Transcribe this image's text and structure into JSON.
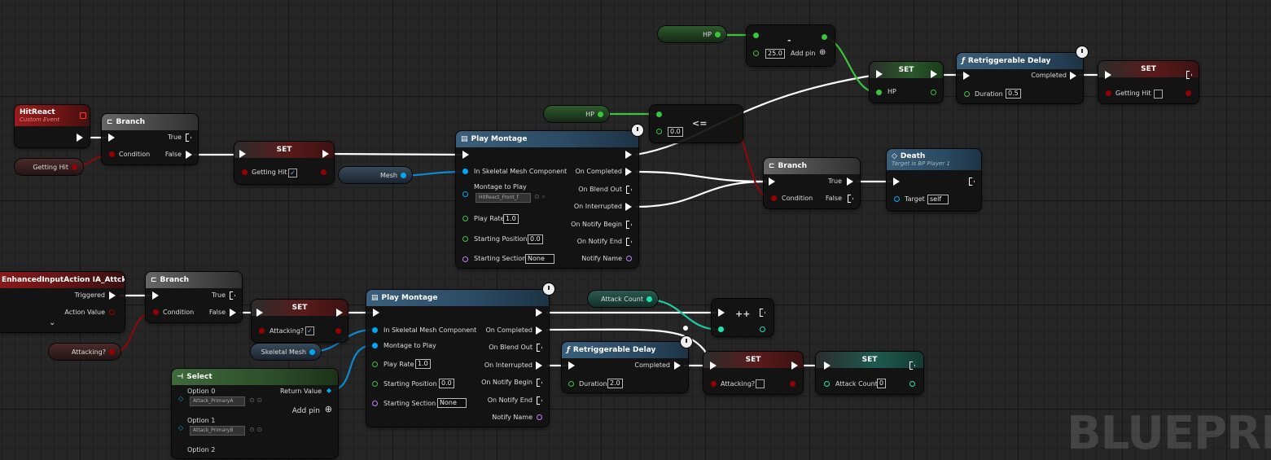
{
  "hit_react": {
    "title": "HitReact",
    "subtitle": "Custom Event",
    "getting_hit_var": "Getting Hit",
    "branch": {
      "title": "Branch",
      "true_label": "True",
      "false_label": "False",
      "condition_label": "Condition"
    },
    "set": {
      "title": "SET",
      "var_label": "Getting Hit"
    },
    "mesh_var": "Mesh",
    "montage": {
      "title": "Play Montage",
      "pins_in": [
        "In Skeletal Mesh Component",
        "Montage to Play",
        "Play Rate",
        "Starting Position",
        "Starting Section"
      ],
      "montage_value": "HitReact_Front_f",
      "play_rate": "1.0",
      "start_pos": "0.0",
      "start_section": "None",
      "pins_out": [
        "On Completed",
        "On Blend Out",
        "On Interrupted",
        "On Notify Begin",
        "On Notify End",
        "Notify Name"
      ]
    },
    "hp_var": "HP",
    "lte": {
      "symbol": "<=",
      "value": "0.0"
    },
    "branch2": {
      "title": "Branch",
      "true_label": "True",
      "false_label": "False",
      "condition_label": "Condition"
    },
    "death": {
      "title": "Death",
      "subtitle": "Target is BP Player 1",
      "target_label": "Target",
      "target_value": "self"
    }
  },
  "hp_update": {
    "hp_var": "HP",
    "minus": {
      "symbol": "-",
      "value": "25.0",
      "add_pin": "Add pin"
    },
    "set": {
      "title": "SET",
      "var_label": "HP"
    },
    "delay": {
      "title": "Retriggerable Delay",
      "completed_label": "Completed",
      "duration_label": "Duration",
      "duration_value": "0.5"
    },
    "set2": {
      "title": "SET",
      "var_label": "Getting Hit"
    }
  },
  "attack": {
    "input": {
      "title": "EnhancedInputAction IA_Attck",
      "triggered": "Triggered",
      "action_value": "Action Value",
      "expand": "⌄"
    },
    "branch": {
      "title": "Branch",
      "true_label": "True",
      "false_label": "False",
      "condition_label": "Condition"
    },
    "attacking_var": "Attacking?",
    "set": {
      "title": "SET",
      "var_label": "Attacking?"
    },
    "skeletal_mesh_var": "Skeletal Mesh",
    "montage": {
      "title": "Play Montage",
      "pins_in": [
        "In Skeletal Mesh Component",
        "Montage to Play",
        "Play Rate",
        "Starting Position",
        "Starting Section"
      ],
      "play_rate": "1.0",
      "start_pos": "0.0",
      "start_section": "None",
      "pins_out": [
        "On Completed",
        "On Blend Out",
        "On Interrupted",
        "On Notify Begin",
        "On Notify End",
        "Notify Name"
      ]
    },
    "select": {
      "title": "Select",
      "option0": "Option 0",
      "option0_value": "Attack_PrimaryA",
      "option1": "Option 1",
      "option1_value": "Attack_PrimaryB",
      "option2": "Option 2",
      "return_value": "Return Value",
      "add_pin": "Add pin"
    },
    "attack_count_var": "Attack Count",
    "increment": {
      "symbol": "++"
    },
    "delay": {
      "title": "Retriggerable Delay",
      "completed_label": "Completed",
      "duration_label": "Duration",
      "duration_value": "2.0"
    },
    "set2": {
      "title": "SET",
      "var_label": "Attacking?"
    },
    "set3": {
      "title": "SET",
      "var_label": "Attack Count",
      "value": "0"
    }
  },
  "watermark": "BLUEPRINT",
  "colors": {
    "exec": "#ffffff",
    "bool": "#950000",
    "float": "#3bc43b",
    "object": "#00a8f4",
    "int": "#1fe3af",
    "name": "#c580ff",
    "accent": "#f0f0f0"
  }
}
